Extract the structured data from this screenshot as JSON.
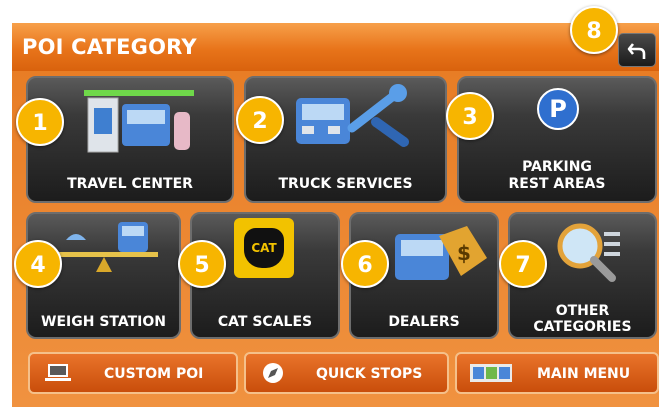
{
  "header": {
    "title": "POI CATEGORY"
  },
  "callouts": [
    "1",
    "2",
    "3",
    "4",
    "5",
    "6",
    "7",
    "8"
  ],
  "tiles": {
    "travel_center": "TRAVEL CENTER",
    "truck_services": "TRUCK SERVICES",
    "parking_line1": "PARKING",
    "parking_line2": "REST AREAS",
    "weigh_station": "WEIGH STATION",
    "cat_scales": "CAT SCALES",
    "dealers": "DEALERS",
    "other_line1": "OTHER",
    "other_line2": "CATEGORIES"
  },
  "bottom": {
    "custom_poi": "CUSTOM POI",
    "quick_stops": "QUICK STOPS",
    "main_menu": "MAIN MENU"
  },
  "icons": {
    "parking_symbol": "P",
    "cat_logo": "CAT",
    "dollar": "$"
  },
  "colors": {
    "accent": "#e8741a",
    "badge": "#f7b500",
    "tile": "#2b2b2b"
  }
}
